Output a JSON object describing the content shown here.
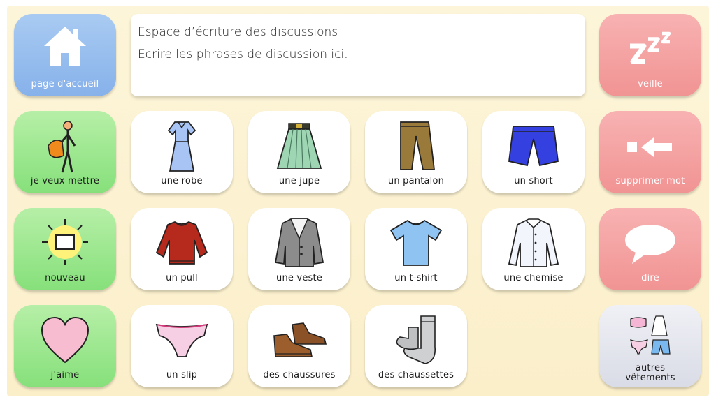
{
  "message_area": {
    "title": "Espace d’écriture des discussions",
    "text": "Ecrire les phrases de discussion ici."
  },
  "tiles": {
    "home": {
      "label": "page d'accueil",
      "icon": "home-icon"
    },
    "sleep": {
      "label": "veille",
      "icon": "zzz-icon"
    },
    "want_wear": {
      "label": "je veux mettre",
      "icon": "person-dressing-icon"
    },
    "dress": {
      "label": "une robe",
      "icon": "dress-icon"
    },
    "skirt": {
      "label": "une jupe",
      "icon": "skirt-icon"
    },
    "trousers": {
      "label": "un pantalon",
      "icon": "trousers-icon"
    },
    "shorts": {
      "label": "un short",
      "icon": "shorts-icon"
    },
    "delete_word": {
      "label": "supprimer mot",
      "icon": "backspace-arrow-icon"
    },
    "new": {
      "label": "nouveau",
      "icon": "sun-new-icon"
    },
    "sweater": {
      "label": "un pull",
      "icon": "sweater-icon"
    },
    "jacket": {
      "label": "une veste",
      "icon": "jacket-icon"
    },
    "tshirt": {
      "label": "un t-shirt",
      "icon": "tshirt-icon"
    },
    "shirt": {
      "label": "une chemise",
      "icon": "shirt-icon"
    },
    "say": {
      "label": "dire",
      "icon": "speech-bubble-icon"
    },
    "like": {
      "label": "j'aime",
      "icon": "heart-icon"
    },
    "underpants": {
      "label": "un slip",
      "icon": "underpants-icon"
    },
    "shoes": {
      "label": "des chaussures",
      "icon": "shoes-icon"
    },
    "socks": {
      "label": "des chaussettes",
      "icon": "socks-icon"
    },
    "other_clothes": {
      "label_line1": "autres",
      "label_line2": "vêtements",
      "icon": "other-clothes-icon"
    }
  },
  "colors": {
    "navigation": "#86b1ea",
    "action": "#f19393",
    "phrase": "#86e07a",
    "vocabulary": "#ffffff",
    "folder": "#d9dbe6",
    "background": "#fbefca"
  }
}
